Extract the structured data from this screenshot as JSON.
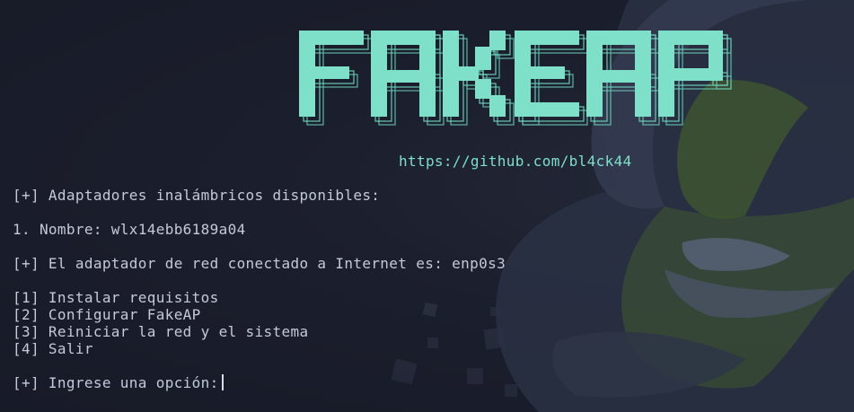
{
  "banner": {
    "title": "FAKEAP",
    "color": "#7ee0c8"
  },
  "url": "https://github.com/bl4ck44",
  "adapters": {
    "header": "[+] Adaptadores inalámbricos disponibles:",
    "items": [
      "1. Nombre: wlx14ebb6189a04"
    ]
  },
  "internet_adapter": "[+] El adaptador de red conectado a Internet es: enp0s3",
  "menu": {
    "options": [
      "[1] Instalar requisitos",
      "[2] Configurar FakeAP",
      "[3] Reiniciar la red y el sistema",
      "[4] Salir"
    ]
  },
  "prompt": "[+] Ingrese una opción:"
}
